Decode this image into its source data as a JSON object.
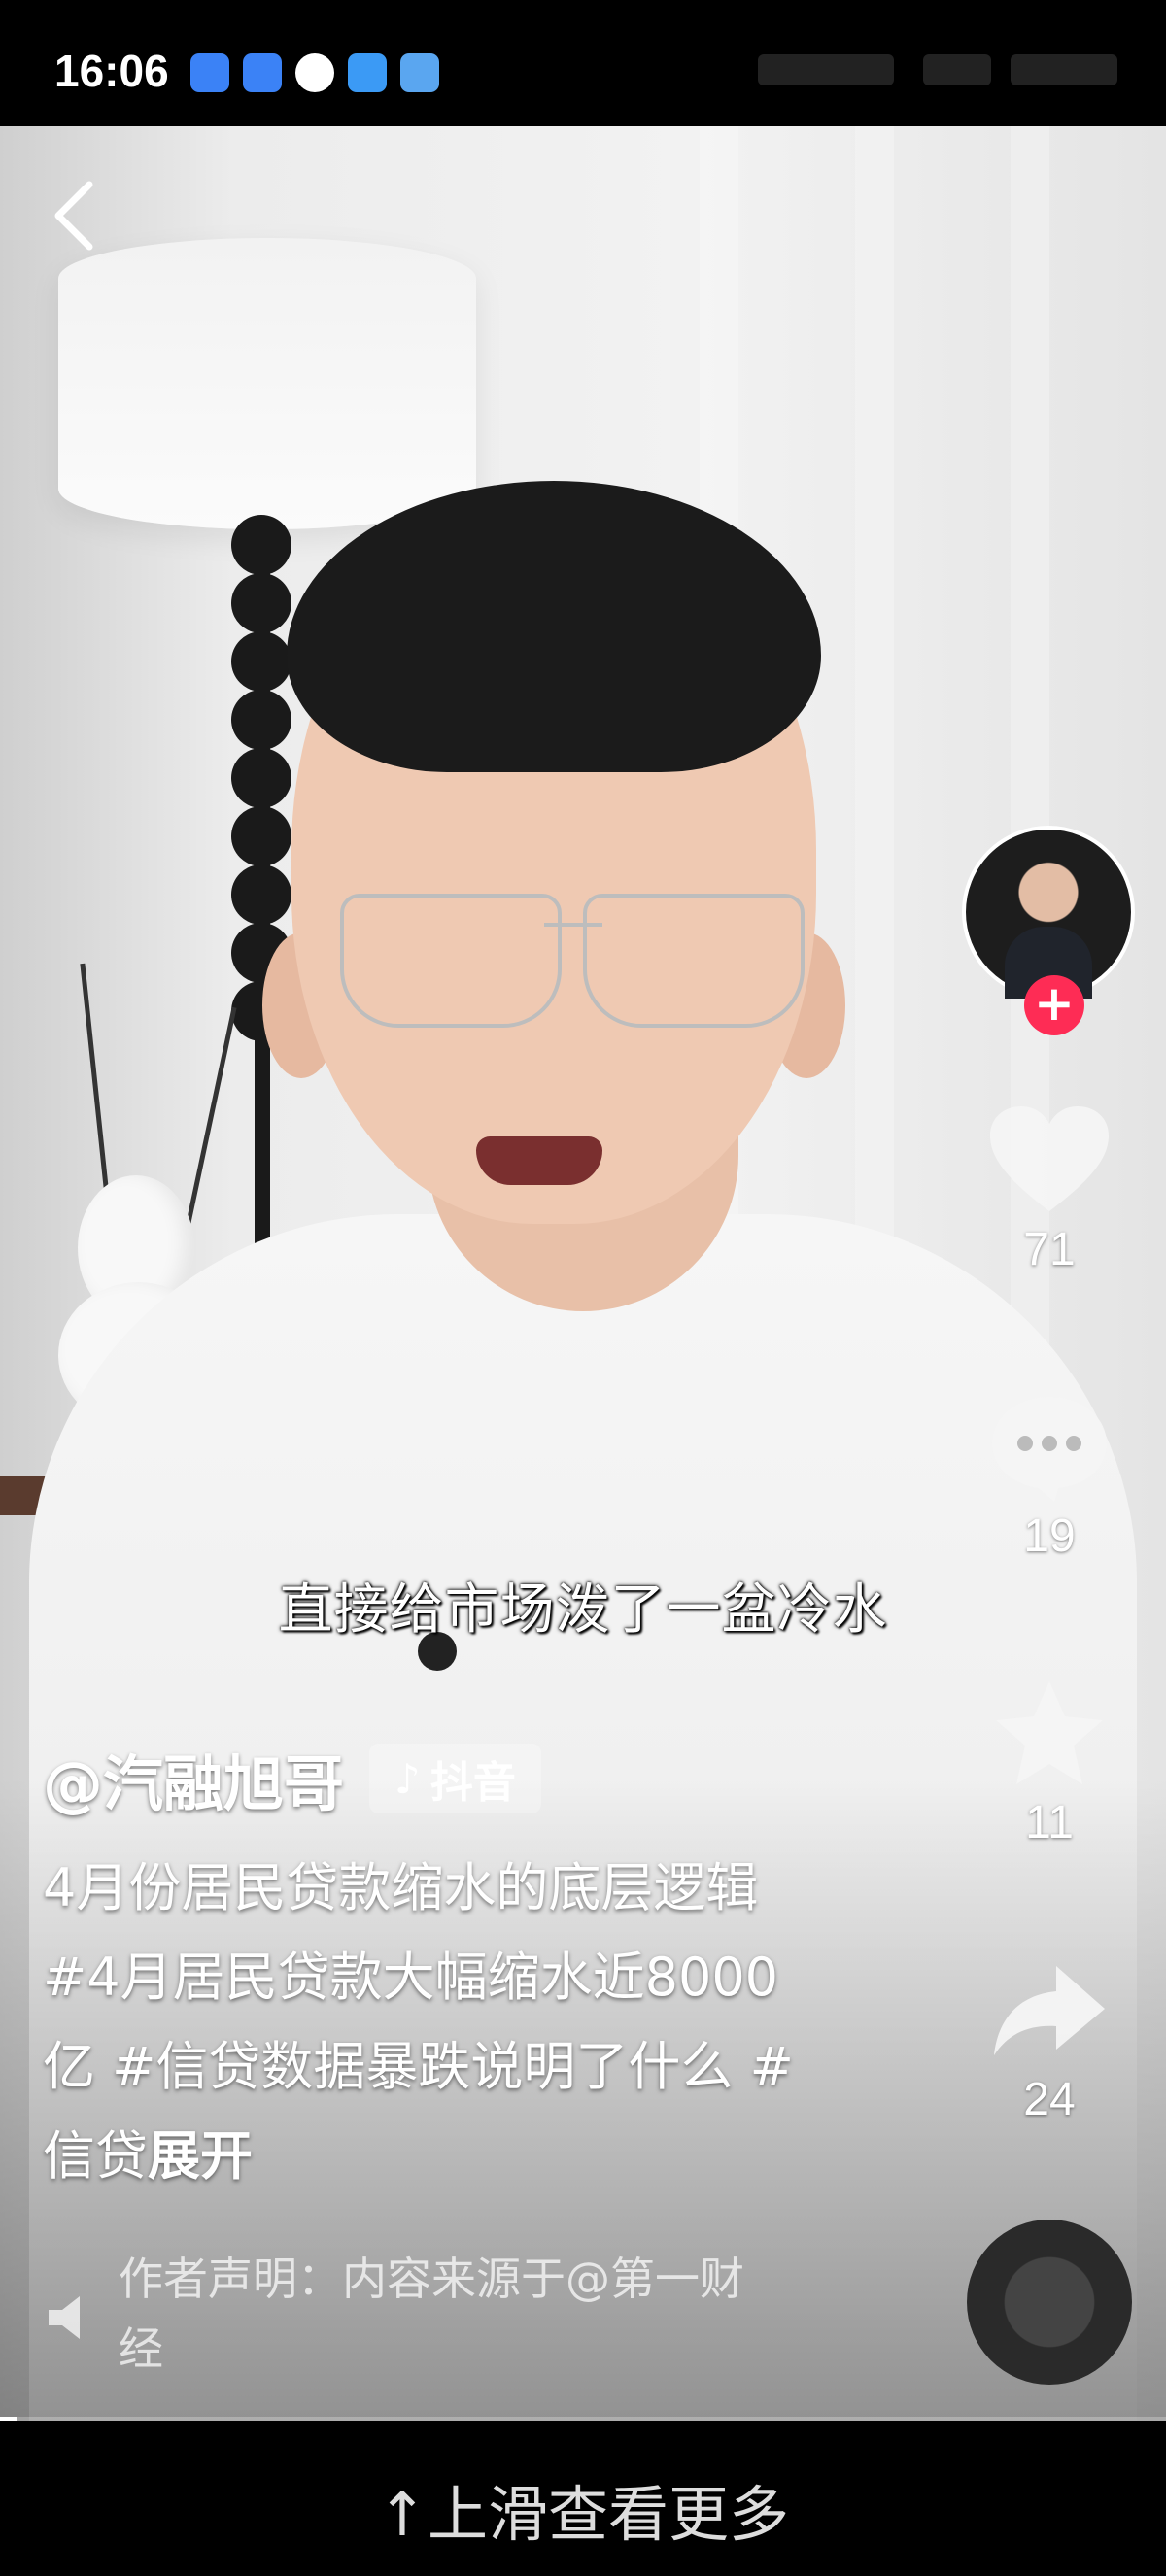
{
  "status_bar": {
    "time": "16:06",
    "icons": [
      "app-market-icon",
      "message-icon",
      "hand-icon",
      "cloud-icon",
      "weather-icon"
    ]
  },
  "video": {
    "subtitle": "直接给市场泼了一盆冷水",
    "author": "@汽融旭哥",
    "app_badge": "抖音",
    "description": "4月份居民贷款缩水的底层逻辑#4月居民贷款大幅缩水近8000亿 #信贷数据暴跌说明了什么 #信贷",
    "expand_label": "展开",
    "declaration": "作者声明：内容来源于@第一财经"
  },
  "actions": {
    "likes": "71",
    "comments": "19",
    "favorites": "11",
    "shares": "24"
  },
  "footer": {
    "swipe_hint": "↑上滑查看更多"
  },
  "playback": {
    "progress_fraction": 0.015
  }
}
